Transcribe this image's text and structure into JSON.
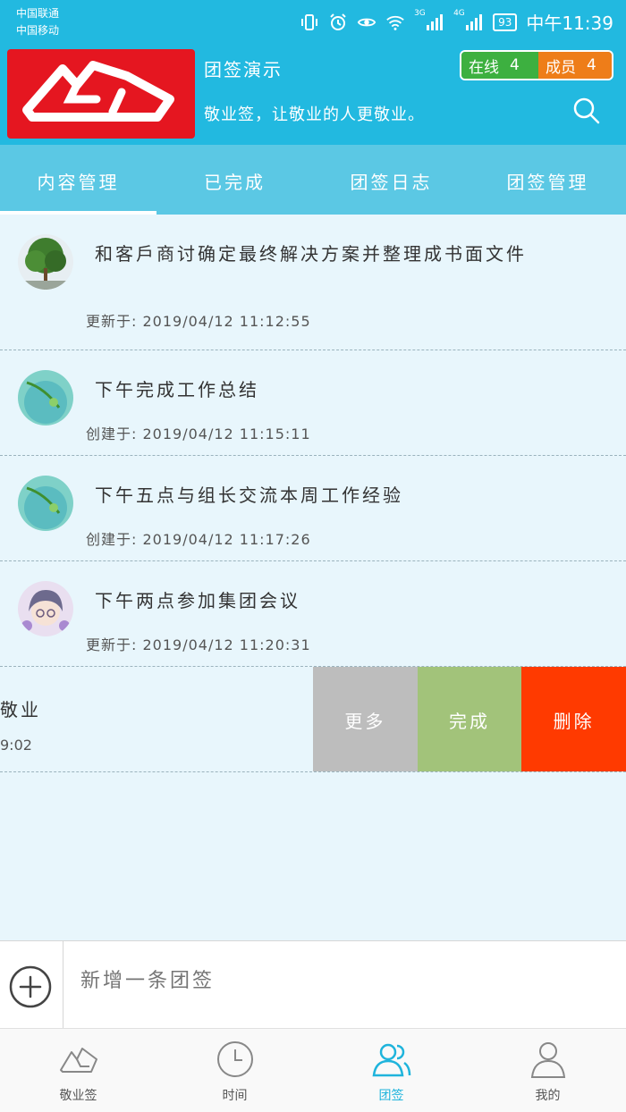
{
  "status": {
    "carrier1": "中国联通",
    "carrier2": "中国移动",
    "battery": "93",
    "time": "中午11:39",
    "net1": "3G",
    "net2": "4G"
  },
  "header": {
    "team_name": "团签演示",
    "slogan": "敬业签，让敬业的人更敬业。",
    "online_label": "在线",
    "online_count": "4",
    "members_label": "成员",
    "members_count": "4"
  },
  "tabs": [
    "内容管理",
    "已完成",
    "团签日志",
    "团签管理"
  ],
  "items": [
    {
      "title": "和客戶商讨确定最终解决方案并整理成书面文件",
      "meta": "更新于: 2019/04/12  11:12:55",
      "avatar": "tree"
    },
    {
      "title": "下午完成工作总结",
      "meta": "创建于: 2019/04/12  11:15:11",
      "avatar": "water"
    },
    {
      "title": "下午五点与组长交流本周工作经验",
      "meta": "创建于: 2019/04/12  11:17:26",
      "avatar": "water"
    },
    {
      "title": "下午两点参加集团会议",
      "meta": "更新于: 2019/04/12  11:20:31",
      "avatar": "anime"
    }
  ],
  "swiped": {
    "peek_title": "敬业",
    "peek_meta": "9:02",
    "more": "更多",
    "done": "完成",
    "delete": "删除"
  },
  "compose": {
    "placeholder": "新增一条团签"
  },
  "nav": [
    "敬业签",
    "时间",
    "团签",
    "我的"
  ],
  "colors": {
    "primary": "#22b9e0",
    "online": "#3db040",
    "members": "#ee7d19",
    "delete": "#ff3a00",
    "done": "#a2c37a",
    "more": "#bdbdbd"
  }
}
